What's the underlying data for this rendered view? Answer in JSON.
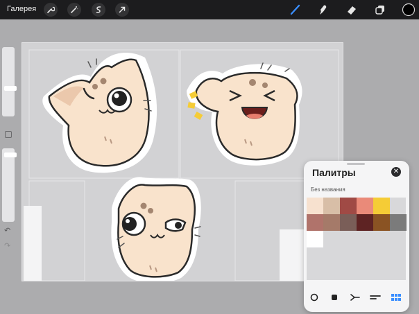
{
  "topbar": {
    "gallery_label": "Галерея",
    "left_tools": [
      {
        "name": "wrench-icon",
        "label": "Действия"
      },
      {
        "name": "magic-wand-icon",
        "label": "Коррекция"
      },
      {
        "name": "selection-icon",
        "label": "Выделение"
      },
      {
        "name": "transform-arrow-icon",
        "label": "Трансформация"
      }
    ],
    "right_tools": [
      {
        "name": "brush-icon",
        "active": true
      },
      {
        "name": "smudge-icon",
        "active": false
      },
      {
        "name": "eraser-icon",
        "active": false
      },
      {
        "name": "layers-icon",
        "active": false
      },
      {
        "name": "color-picker-icon",
        "active": false
      }
    ],
    "accent_color": "#3a8eff",
    "current_color": "#000000"
  },
  "sidebar": {
    "brush_size": 0.28,
    "opacity": 0.05,
    "undo_icon": "undo-icon",
    "redo_icon": "redo-icon"
  },
  "palettes_panel": {
    "title": "Палитры",
    "palette_name": "Без названия",
    "swatches": [
      "#f7e1cf",
      "#d8bea7",
      "#a04a45",
      "#ea8a79",
      "#f5cc36",
      null,
      null,
      "#b0736b",
      null,
      "#a57a69",
      "#7a5e58",
      "#5e2323",
      null,
      "#8a5323",
      "#7b7b7b",
      "#ffffff"
    ],
    "view_modes": [
      "circle-icon",
      "square-icon",
      "branch-icon",
      "lines-icon",
      "grid-icon"
    ],
    "active_view": "grid-icon"
  }
}
